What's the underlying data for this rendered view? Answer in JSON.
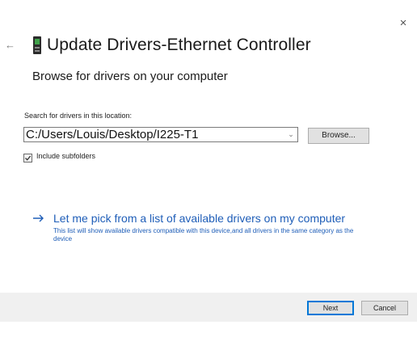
{
  "window": {
    "close_glyph": "×",
    "back_glyph": "←"
  },
  "header": {
    "title": "Update Drivers-Ethernet Controller",
    "icon": "network-adapter-icon"
  },
  "main": {
    "subtitle": "Browse for drivers on your computer",
    "search_label": "Search for drivers in this location:",
    "path_value": "C:/Users/Louis/Desktop/I225-T1",
    "combo_arrow": "⌄",
    "browse_label": "Browse...",
    "include_subfolders_label": "Include subfolders",
    "include_subfolders_checked": true,
    "pick_link": "Let me pick from a list of available drivers on my computer",
    "pick_desc": "This list will show available drivers compatible with this device,and all drivers in the same category as the device"
  },
  "footer": {
    "next_label": "Next",
    "cancel_label": "Cancel"
  },
  "colors": {
    "link": "#1f5eb8",
    "accent": "#0078d7",
    "footer_bg": "#f0f0f0"
  }
}
